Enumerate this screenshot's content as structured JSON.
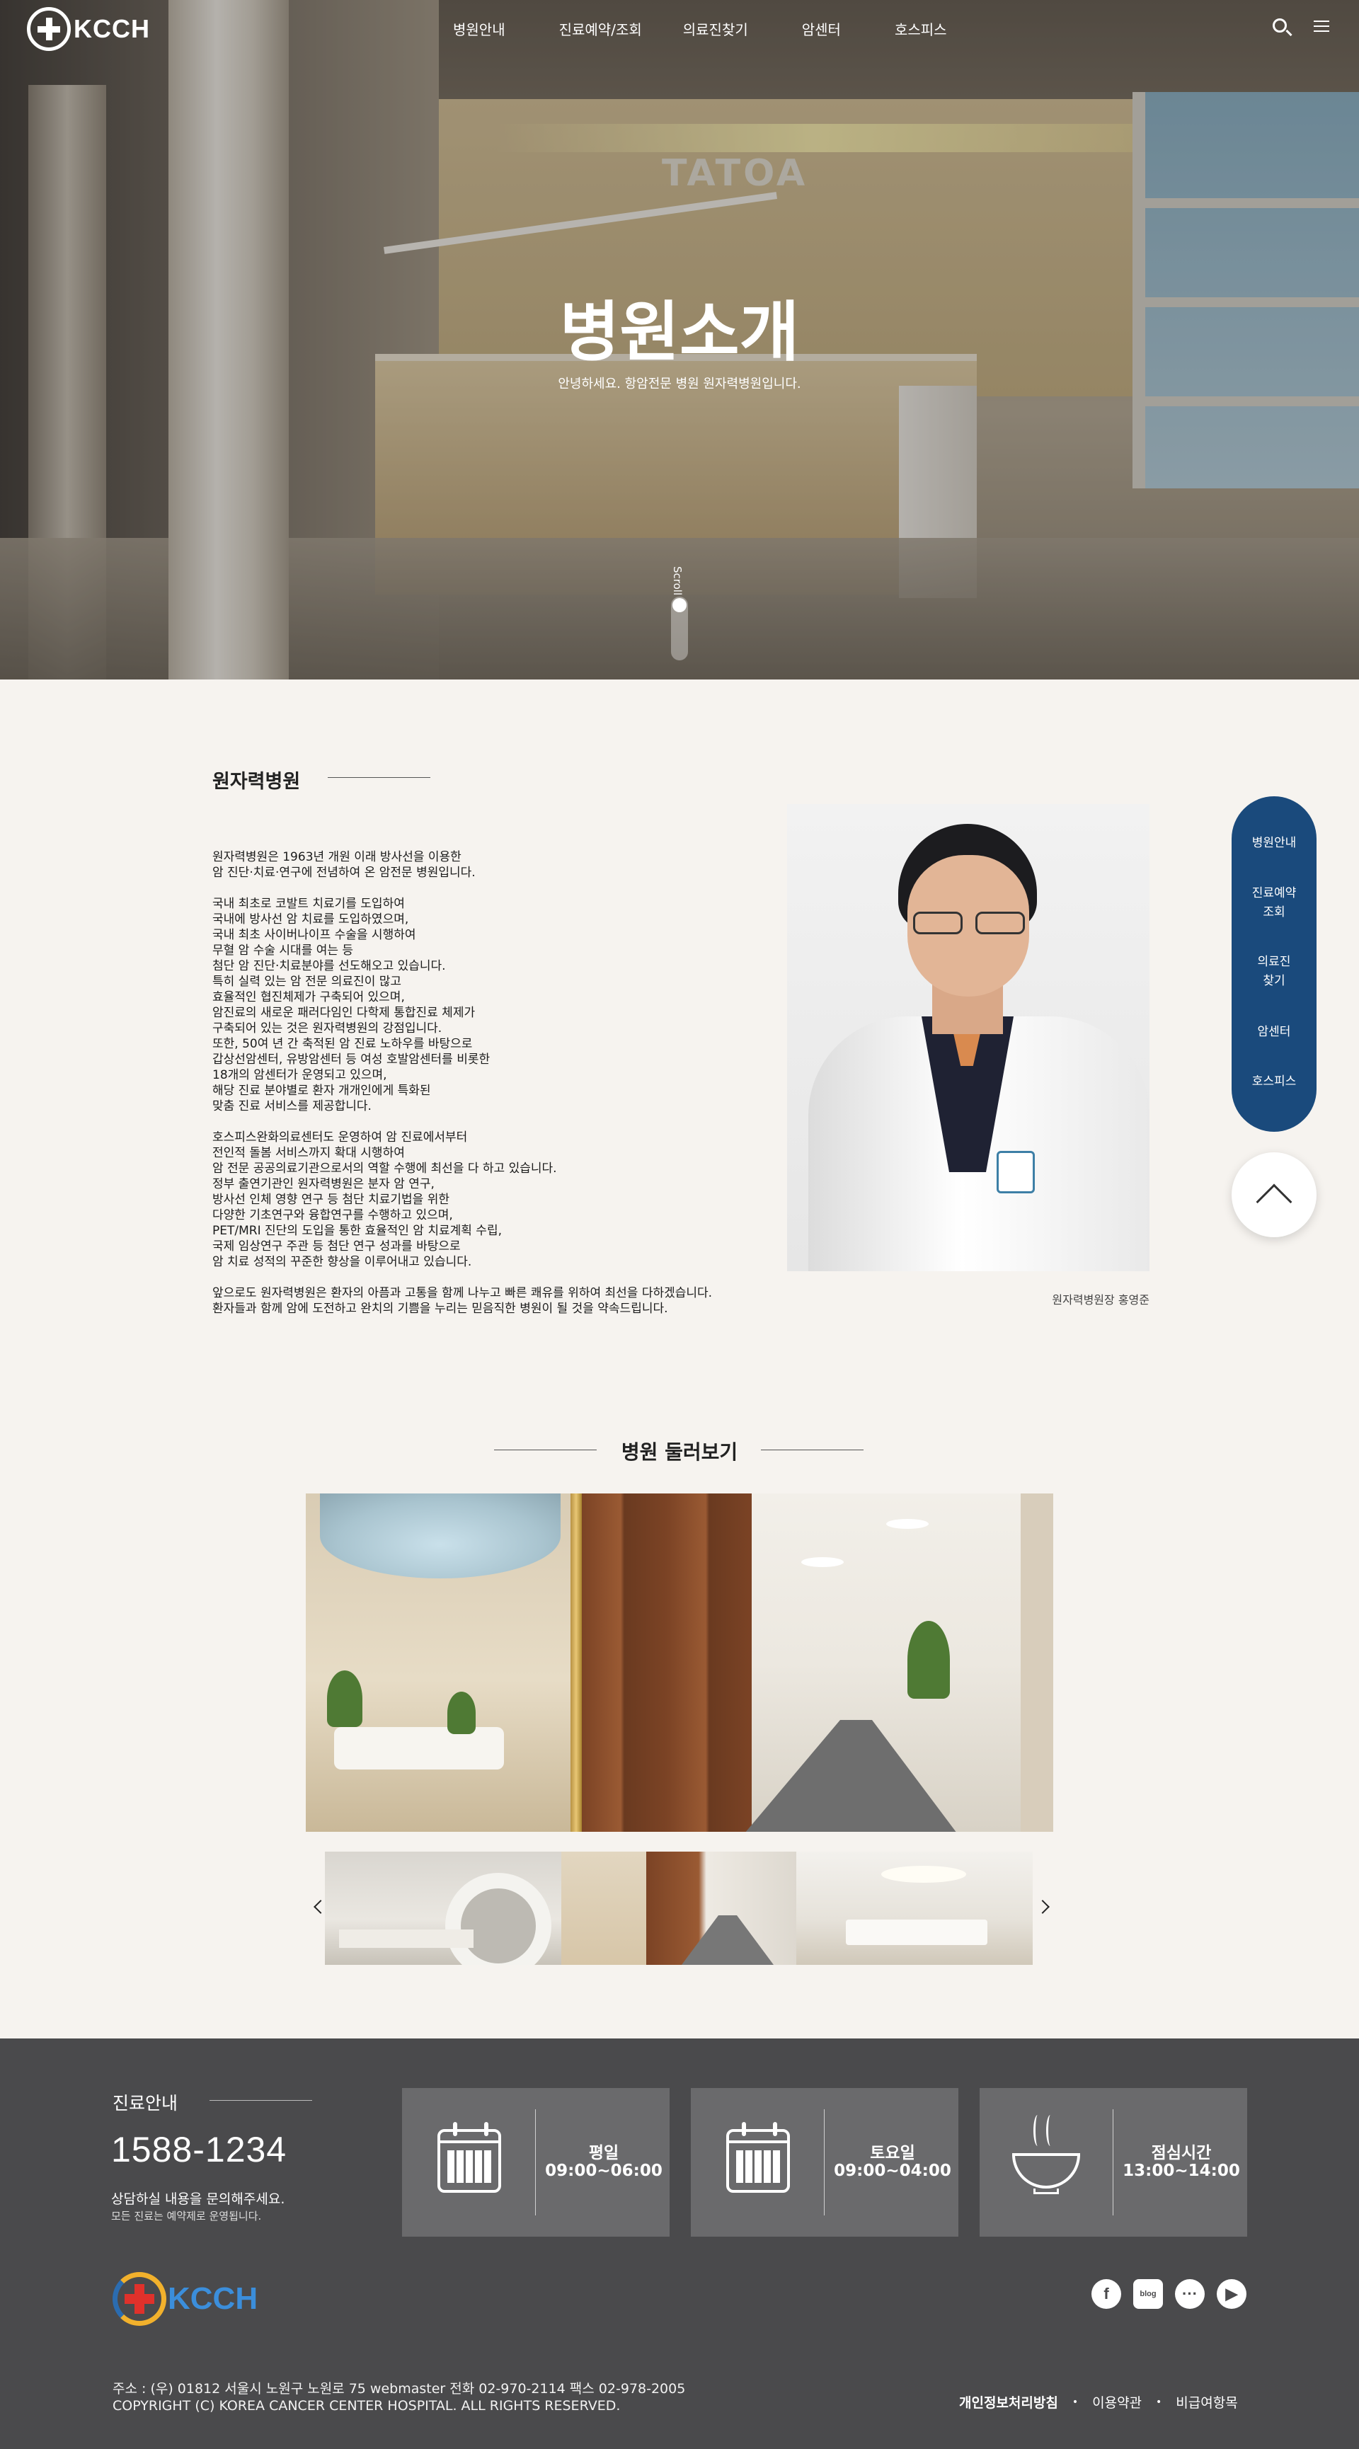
{
  "header": {
    "logo_text": "KCCH",
    "nav": [
      "병원안내",
      "진료예약/조회",
      "의료진찾기",
      "암센터",
      "호스피스"
    ]
  },
  "hero": {
    "sign_text": "TATOA",
    "title": "병원소개",
    "subtitle": "안녕하세요. 항암전문 병원 원자력병원입니다.",
    "scroll_label": "Scroll"
  },
  "intro": {
    "heading": "원자력병원",
    "paragraphs": [
      "원자력병원은 1963년 개원 이래 방사선을 이용한\n암 진단·치료·연구에 전념하여 온 암전문 병원입니다.",
      "국내 최초로 코발트 치료기를 도입하여\n국내에 방사선 암 치료를 도입하였으며,\n국내 최초 사이버나이프 수술을 시행하여\n무혈 암 수술 시대를 여는 등\n첨단 암 진단·치료분야를 선도해오고 있습니다.\n특히 실력 있는 암 전문 의료진이 많고\n효율적인 협진체제가 구축되어 있으며,\n암진료의 새로운 패러다임인 다학제 통합진료 체제가\n구축되어 있는 것은 원자력병원의 강점입니다.\n또한, 50여 년 간 축적된 암 진료 노하우를 바탕으로\n갑상선암센터, 유방암센터 등 여성 호발암센터를 비롯한\n18개의 암센터가 운영되고 있으며,\n해당 진료 분야별로 환자 개개인에게 특화된\n맞춤 진료 서비스를 제공합니다.",
      "호스피스완화의료센터도 운영하여 암 진료에서부터\n전인적 돌봄 서비스까지 확대 시행하여\n암 전문 공공의료기관으로서의 역할 수행에 최선을 다 하고 있습니다.\n정부 출연기관인 원자력병원은 분자 암 연구,\n방사선 인체 영향 연구 등 첨단 치료기법을 위한\n다양한 기초연구와 융합연구를 수행하고 있으며,\nPET/MRI 진단의 도입을 통한 효율적인 암 치료계획 수립,\n국제 임상연구 주관 등 첨단 연구 성과를 바탕으로\n암 치료 성적의 꾸준한 향상을 이루어내고 있습니다.",
      "앞으로도 원자력병원은 환자의 아픔과 고통을 함께 나누고 빠른 쾌유를 위하여 최선을 다하겠습니다.\n환자들과 함께 암에 도전하고 완치의 기쁨을 누리는 믿음직한 병원이 될 것을 약속드립니다."
    ],
    "portrait_caption": "원자력병원장 홍영준"
  },
  "quick_nav": {
    "items": [
      "병원안내",
      "진료예약\n조회",
      "의료진\n찾기",
      "암센터",
      "호스피스"
    ]
  },
  "gallery": {
    "title": "병원 둘러보기"
  },
  "footer": {
    "label": "진료안내",
    "phone": "1588-1234",
    "ask": "상담하실 내용을 문의해주세요.",
    "note": "모든 진료는 예약제로 운영됩니다.",
    "boxes": [
      {
        "title": "평일",
        "time": "09:00~06:00",
        "icon": "calendar-icon"
      },
      {
        "title": "토요일",
        "time": "09:00~04:00",
        "icon": "calendar-icon"
      },
      {
        "title": "점심시간",
        "time": "13:00~14:00",
        "icon": "bowl-icon"
      }
    ],
    "logo_text": "KCCH",
    "sns": [
      "facebook-icon",
      "blog-icon",
      "talk-icon",
      "youtube-icon"
    ],
    "sns_labels": {
      "facebook": "f",
      "blog": "blog",
      "talk": "···",
      "youtube": "▶"
    },
    "address": "주소 : (우) 01812 서울시 노원구 노원로 75 webmaster 전화 02-970-2114 팩스 02-978-2005",
    "copyright": "COPYRIGHT (C) KOREA CANCER CENTER HOSPITAL. ALL RIGHTS RESERVED.",
    "links": [
      "개인정보처리방침",
      "이용약관",
      "비급여항목"
    ]
  },
  "colors": {
    "quick_nav_bg": "#1a4a7c",
    "footer_bg": "#4a4a4c",
    "page_bg": "#f6f3ef"
  }
}
